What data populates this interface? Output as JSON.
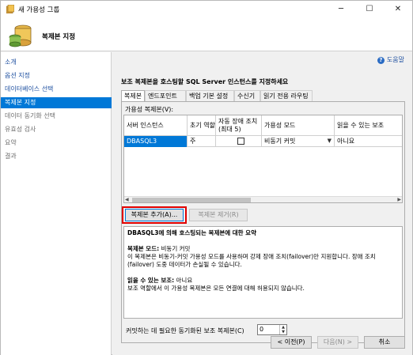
{
  "window": {
    "title": "새 가용성 그룹",
    "minimize": "─",
    "maximize": "☐",
    "close": "✕"
  },
  "header": {
    "heading": "복제본 지정"
  },
  "sidebar": {
    "items": [
      {
        "label": "소개",
        "state": "link"
      },
      {
        "label": "옵션 지정",
        "state": "link"
      },
      {
        "label": "데이터베이스 선택",
        "state": "link"
      },
      {
        "label": "복제본 지정",
        "state": "active"
      },
      {
        "label": "데이터 동기화 선택",
        "state": "disabled"
      },
      {
        "label": "유효성 검사",
        "state": "disabled"
      },
      {
        "label": "요약",
        "state": "disabled"
      },
      {
        "label": "결과",
        "state": "disabled"
      }
    ]
  },
  "main": {
    "help": "도움말",
    "instruction": "보조 복제본을 호스팅할 SQL Server 인스턴스를 지정하세요",
    "tabs": [
      "복제본",
      "엔드포인트",
      "백업 기본 설정",
      "수신기",
      "읽기 전용 라우팅"
    ],
    "group_label": "가용성 복제본(V):",
    "grid": {
      "headers": [
        "서버 인스턴스",
        "초기 역할",
        "자동 장애 조치(최대 5)",
        "가용성 모드",
        "읽을 수 있는 보조"
      ],
      "rows": [
        {
          "server": "DBASQL3",
          "role": "주",
          "auto_failover": false,
          "mode": "비동기 커밋",
          "readable": "아니요"
        }
      ]
    },
    "add_replica": "복제본 추가(A)...",
    "remove_replica": "복제본 제거(R)",
    "summary": {
      "title": "DBASQL3에 의해 호스팅되는 복제본에 대한 요약",
      "mode_head": "복제본 모드:",
      "mode_value": "비동기 커밋",
      "mode_desc": "이 복제본은 비동기-커밋 가용성 모드를 사용하며 강제 장애 조치(failover)만 지원합니다. 장애 조치(failover) 도중 데이터가 손실될 수 있습니다.",
      "readable_head": "읽을 수 있는 보조:",
      "readable_value": "아니요",
      "readable_desc": "보조 역할에서 이 가용성 복제본은 모든 연결에 대해 허용되지 않습니다."
    },
    "commit_label": "커밋하는 데 필요한 동기화된 보조 복제본(C)",
    "commit_value": "0"
  },
  "footer": {
    "prev": "< 이전(P)",
    "next": "다음(N) >",
    "cancel": "취소"
  }
}
